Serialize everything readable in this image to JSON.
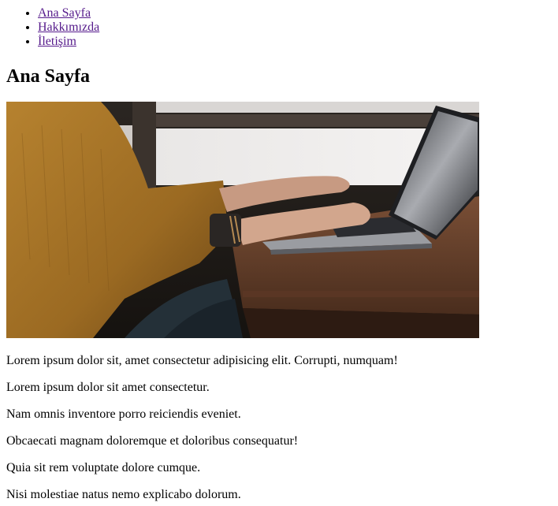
{
  "nav": {
    "items": [
      {
        "label": "Ana Sayfa"
      },
      {
        "label": "Hakkımızda"
      },
      {
        "label": "İletişim"
      }
    ]
  },
  "page_title": "Ana Sayfa",
  "hero_image": {
    "subject": "person in mustard sweater typing on a laptop at a wooden table by a window"
  },
  "paragraphs": [
    "Lorem ipsum dolor sit, amet consectetur adipisicing elit. Corrupti, numquam!",
    "Lorem ipsum dolor sit amet consectetur.",
    "Nam omnis inventore porro reiciendis eveniet.",
    "Obcaecati magnam doloremque et doloribus consequatur!",
    "Quia sit rem voluptate dolore cumque.",
    "Nisi molestiae natus nemo explicabo dolorum."
  ],
  "colors": {
    "link_visited": "#551a8b",
    "text": "#000000",
    "background": "#ffffff"
  }
}
